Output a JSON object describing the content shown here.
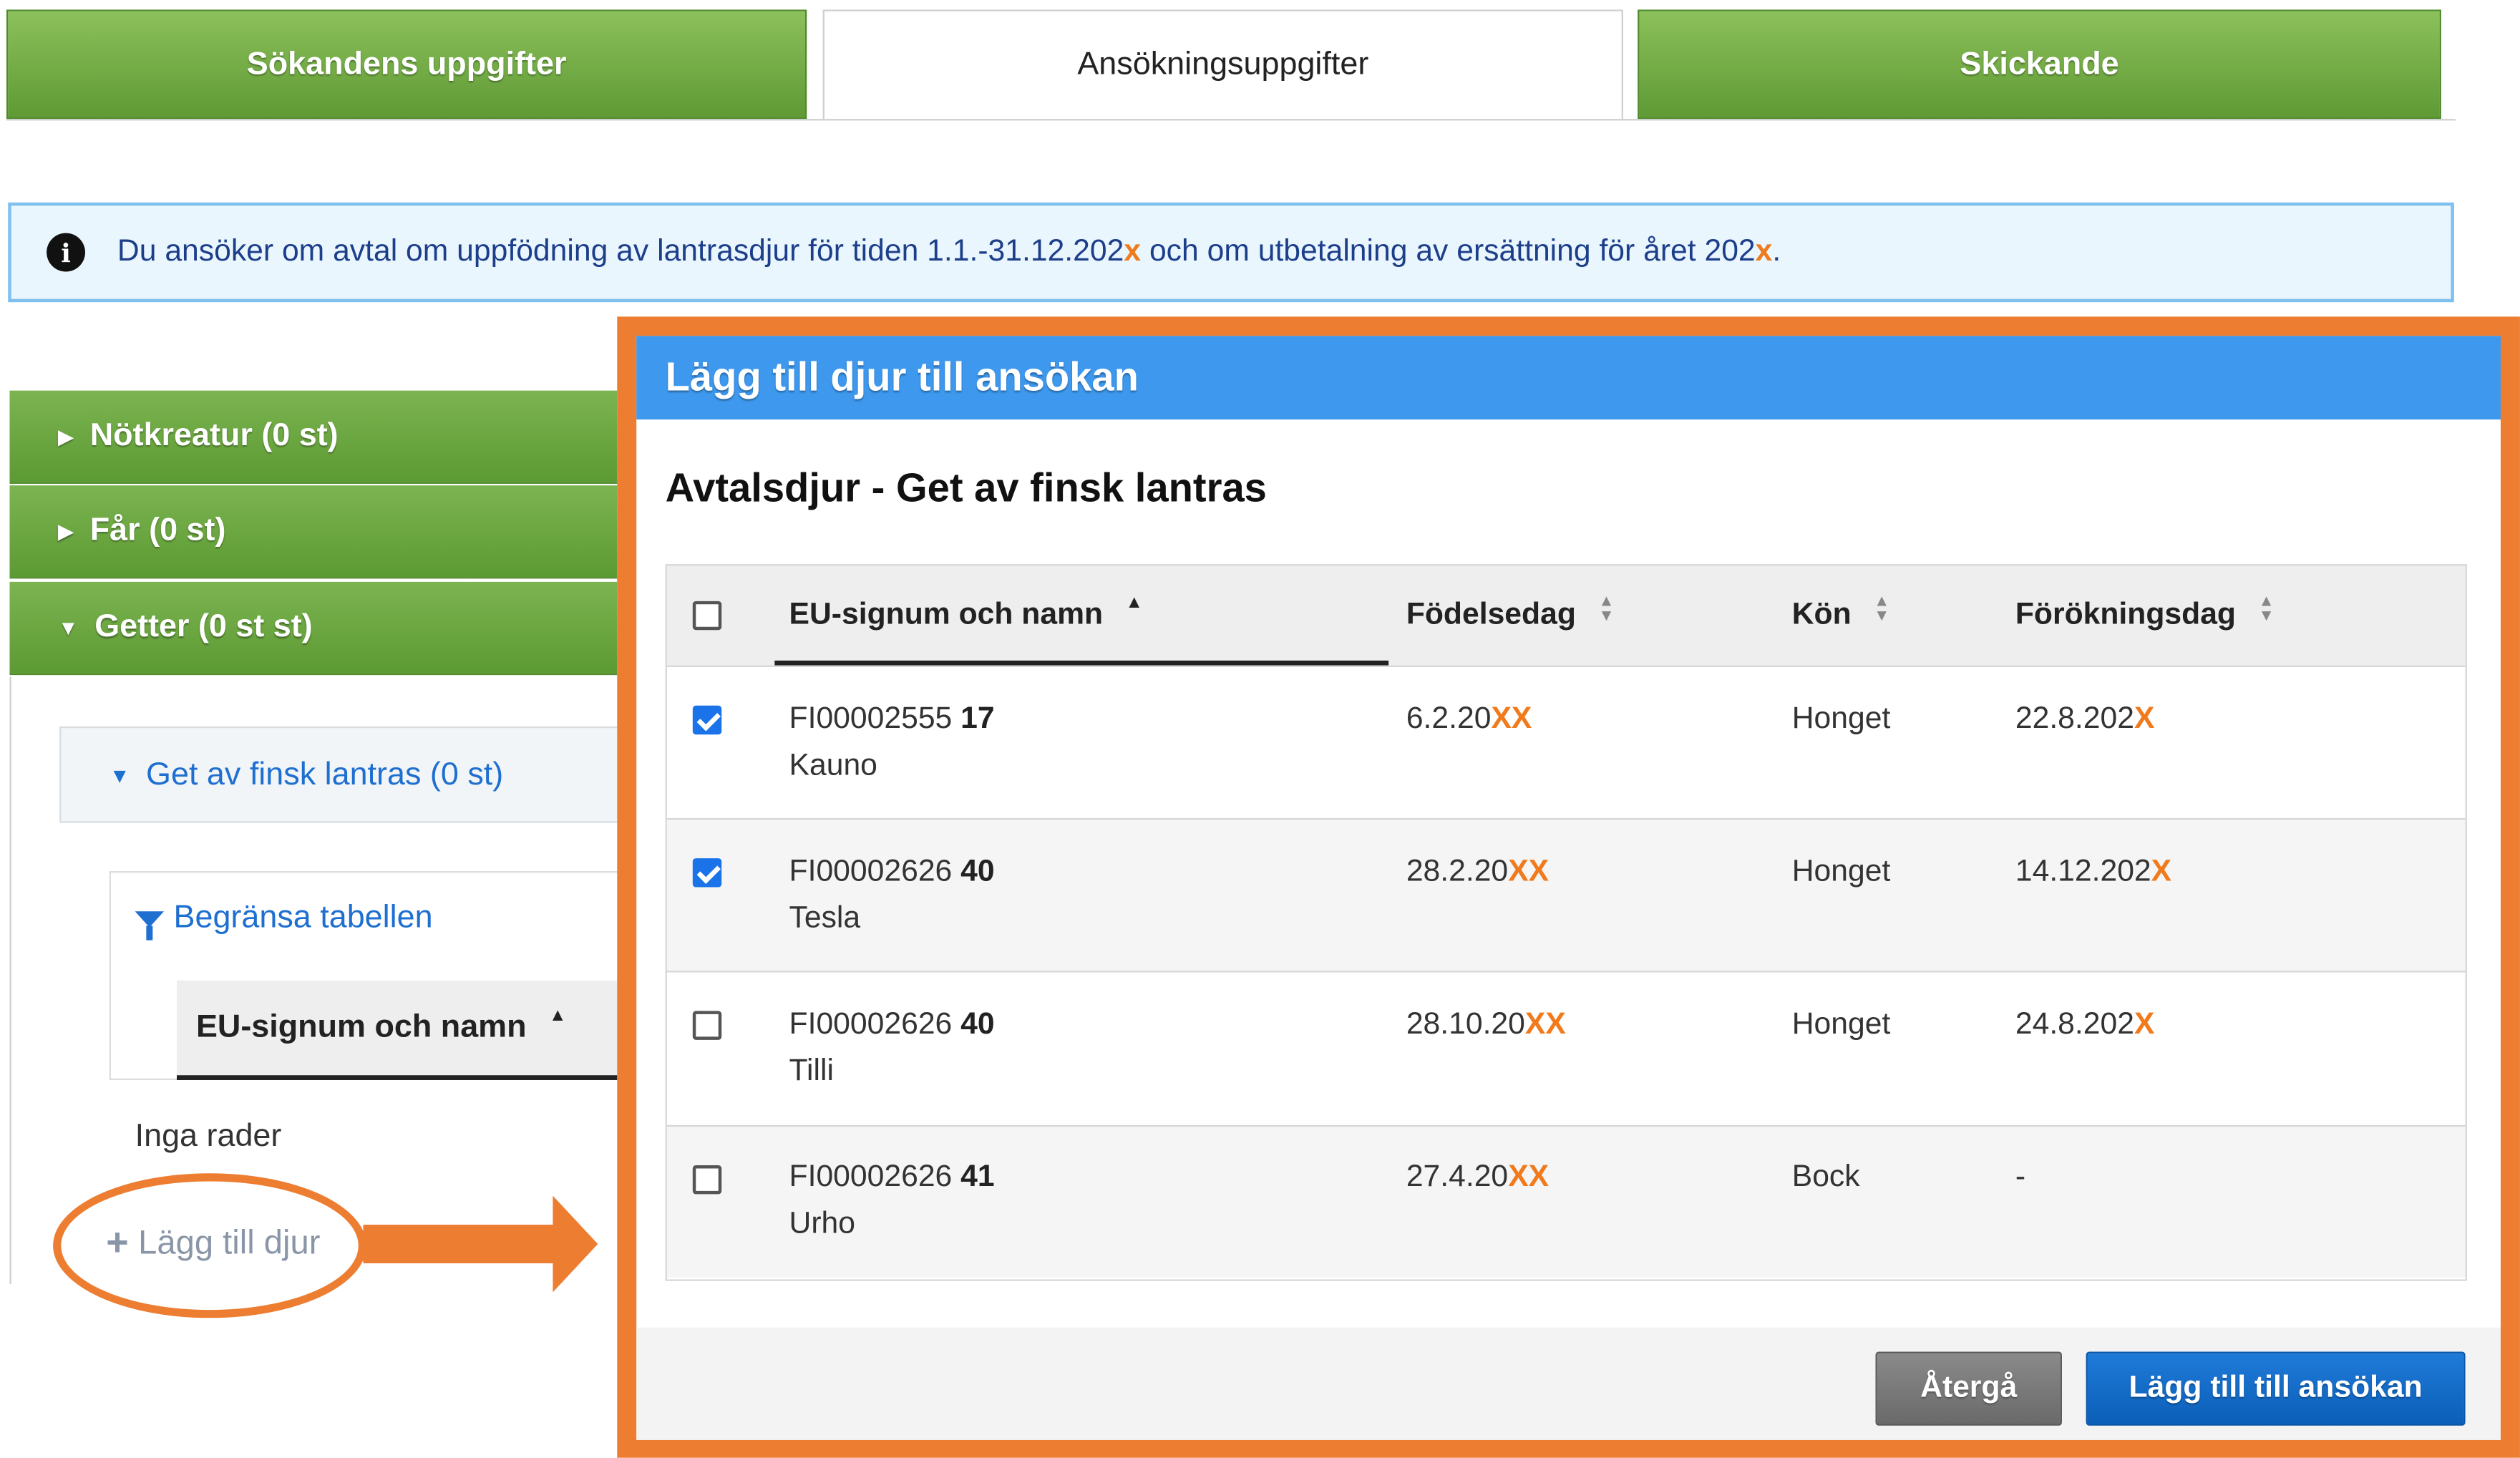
{
  "tabs": [
    {
      "label": "Sökandens uppgifter",
      "state": "inactive"
    },
    {
      "label": "Ansökningsuppgifter",
      "state": "active"
    },
    {
      "label": "Skickande",
      "state": "inactive"
    }
  ],
  "info": {
    "text_1": "Du ansöker om avtal om uppfödning av lantrasdjur för tiden 1.1.-31.12.202",
    "x_1": "x",
    "text_2": " och om utbetalning av ersättning för året 202",
    "x_2": "x",
    "text_3": "."
  },
  "accordion": [
    {
      "label": "Nötkreatur (0 st)",
      "expanded": false
    },
    {
      "label": "Får (0 st)",
      "expanded": false
    },
    {
      "label": "Getter (0 st st)",
      "expanded": true
    }
  ],
  "sub_section": {
    "label": "Get av finsk lantras (0 st)"
  },
  "left_table": {
    "filter_label": "Begränsa tabellen",
    "column": "EU-signum och namn",
    "empty_text": "Inga rader",
    "add_label": "Lägg till djur"
  },
  "dialog": {
    "header": "Lägg till djur till ansökan",
    "title": "Avtalsdjur - Get av finsk lantras",
    "columns": [
      "EU-signum och namn",
      "Födelsedag",
      "Kön",
      "Förökningsdag"
    ],
    "rows": [
      {
        "checked": true,
        "id": "FI00002555 ",
        "id_bold": "17",
        "name": "Kauno",
        "birth": "6.2.20",
        "birth_x": "XX",
        "sex": "Honget",
        "breed": "22.8.202",
        "breed_x": "X"
      },
      {
        "checked": true,
        "id": "FI00002626 ",
        "id_bold": "40",
        "name": "Tesla",
        "birth": "28.2.20",
        "birth_x": "XX",
        "sex": "Honget",
        "breed": "14.12.202",
        "breed_x": "X"
      },
      {
        "checked": false,
        "id": "FI00002626 ",
        "id_bold": "40",
        "name": "Tilli",
        "birth": "28.10.20",
        "birth_x": "XX",
        "sex": "Honget",
        "breed": "24.8.202",
        "breed_x": "X"
      },
      {
        "checked": false,
        "id": "FI00002626 ",
        "id_bold": "41",
        "name": "Urho",
        "birth": "27.4.20",
        "birth_x": "XX",
        "sex": "Bock",
        "breed": "-",
        "breed_x": ""
      }
    ],
    "cancel_label": "Återgå",
    "submit_label": "Lägg till till ansökan"
  },
  "colors": {
    "tab_green": "#6fa843",
    "dialog_blue": "#3d98ee",
    "highlight_orange": "#ed7d31",
    "link_blue": "#1e6fd0"
  }
}
